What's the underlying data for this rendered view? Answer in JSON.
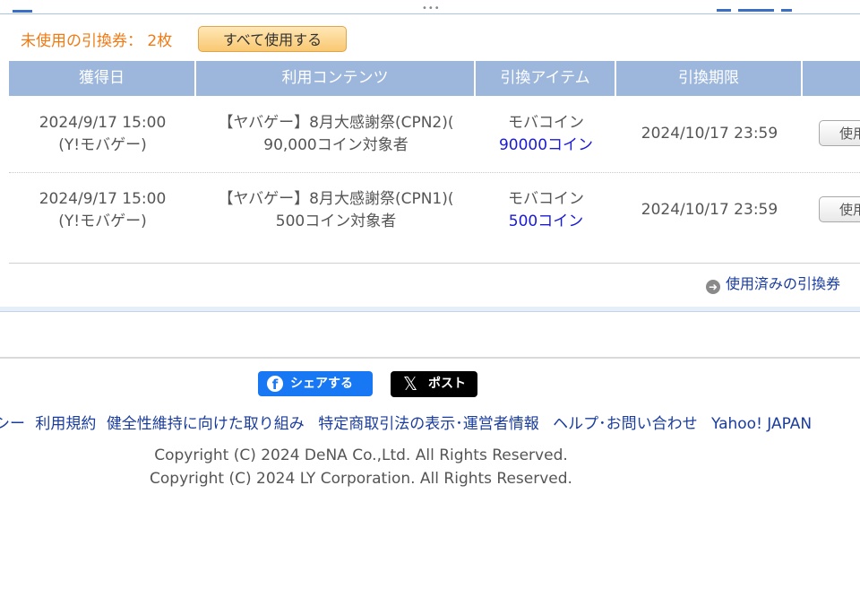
{
  "summary": {
    "unused_label": "未使用の引換券： 2枚",
    "use_all_label": "すべて使用する"
  },
  "table": {
    "headers": [
      "獲得日",
      "利用コンテンツ",
      "引換アイテム",
      "引換期限",
      ""
    ],
    "rows": [
      {
        "date": "2024/9/17 15:00",
        "source": "(Y!モバゲー)",
        "content_line1": "【ヤバゲー】8月大感謝祭(CPN2)(",
        "content_line2": "90,000コイン対象者",
        "item_name": "モバコイン",
        "item_amount": "90000コイン",
        "expiry": "2024/10/17 23:59",
        "use_label": "使用"
      },
      {
        "date": "2024/9/17 15:00",
        "source": "(Y!モバゲー)",
        "content_line1": "【ヤバゲー】8月大感謝祭(CPN1)(",
        "content_line2": "500コイン対象者",
        "item_name": "モバコイン",
        "item_amount": "500コイン",
        "expiry": "2024/10/17 23:59",
        "use_label": "使用"
      }
    ]
  },
  "used_link": {
    "icon": "arrow-right-circle-icon",
    "label": "使用済みの引換券"
  },
  "share": {
    "facebook_label": "シェアする",
    "x_label": "ポスト"
  },
  "footer": {
    "links": [
      "シー",
      "利用規約",
      "健全性維持に向けた取り組み",
      "特定商取引法の表示･運営者情報",
      "ヘルプ･お問い合わせ",
      "Yahoo! JAPAN"
    ],
    "copyright": [
      "Copyright (C) 2024 DeNA Co.,Ltd. All Rights Reserved.",
      "Copyright (C) 2024 LY Corporation. All Rights Reserved."
    ]
  },
  "colors": {
    "accent_orange": "#f07a14",
    "header_blue": "#9db7dc",
    "link_blue": "#1a1ad4",
    "facebook": "#1877f2"
  }
}
